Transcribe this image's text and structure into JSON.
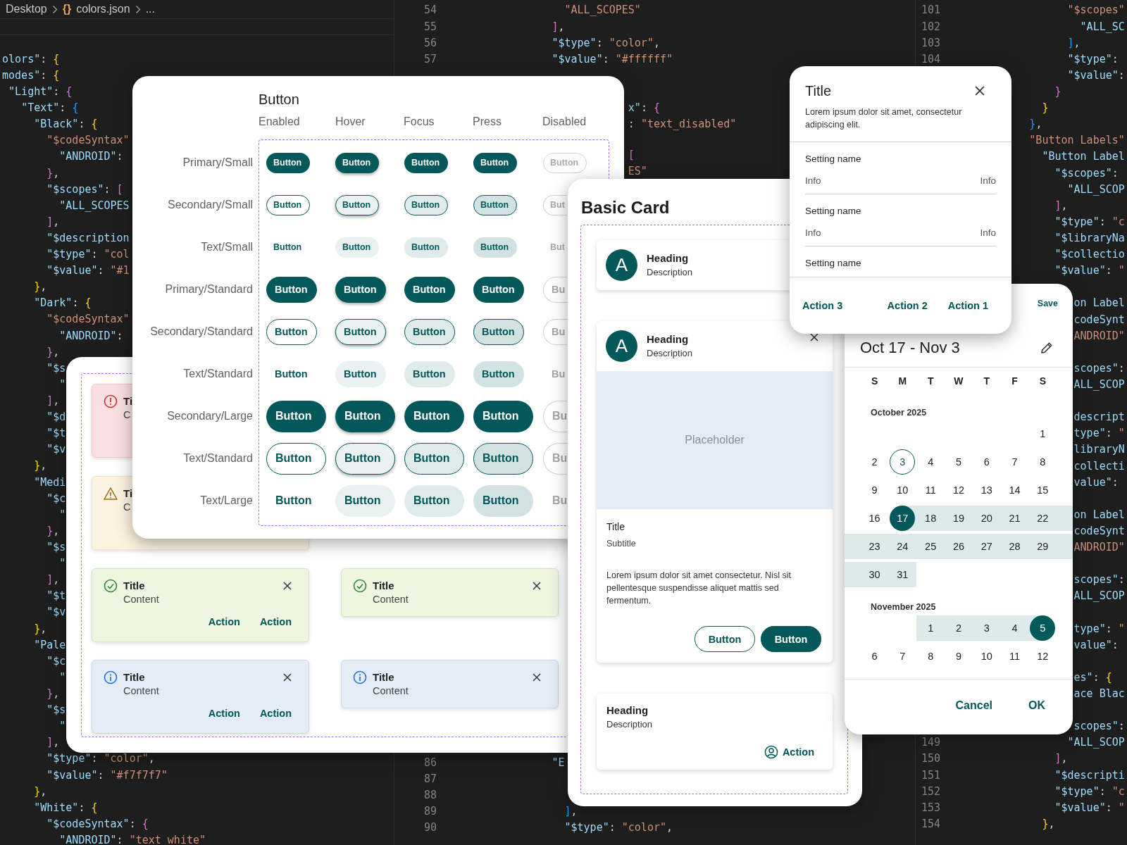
{
  "editor": {
    "breadcrumb": {
      "folder": "Desktop",
      "file_icon": "{}",
      "file": "colors.json",
      "more": "..."
    },
    "panes": [
      {
        "blocks": [
          {
            "lines": [
              {
                "text": " olors\": {"
              },
              {
                "text": " modes\": {"
              },
              {
                "text": "  \"Light\": {"
              },
              {
                "text": "    \"Text\": {"
              },
              {
                "text": "      \"Black\": {"
              },
              {
                "text": "        \"$codeSyntax\""
              },
              {
                "text": "          \"ANDROID\":"
              },
              {
                "text": "        },"
              },
              {
                "text": "        \"$scopes\": ["
              },
              {
                "text": "          \"ALL_SCOPES"
              },
              {
                "text": "        ],"
              },
              {
                "text": "        \"$description"
              },
              {
                "text": "        \"$type\": \"col"
              },
              {
                "text": "        \"$value\": \"#1"
              },
              {
                "text": "      },"
              },
              {
                "text": "      \"Dark\": {"
              },
              {
                "text": "        \"$codeSyntax\""
              },
              {
                "text": "          \"ANDROID\":"
              },
              {
                "text": "        },"
              },
              {
                "text": "        \"$s"
              },
              {
                "text": "          \""
              },
              {
                "text": "        ],"
              },
              {
                "text": "        \"$d"
              },
              {
                "text": "        \"$t"
              },
              {
                "text": "        \"$v"
              },
              {
                "text": "      },"
              },
              {
                "text": "      \"Medi"
              },
              {
                "text": "        \"$c"
              },
              {
                "text": "          \""
              },
              {
                "text": "        },"
              },
              {
                "text": "        \"$s"
              },
              {
                "text": "          \""
              },
              {
                "text": "        ],"
              },
              {
                "text": "        \"$t"
              },
              {
                "text": "        \"$v"
              },
              {
                "text": "      },"
              },
              {
                "text": "      \"Pale"
              },
              {
                "text": "        \"$c"
              },
              {
                "text": "          \""
              },
              {
                "text": "        },"
              },
              {
                "text": "        \"$s"
              },
              {
                "text": "          \""
              },
              {
                "text": "        ],"
              },
              {
                "text": "        \"$type\": \"color\","
              },
              {
                "text": "        \"$value\": \"#f7f7f7\""
              },
              {
                "text": "      },"
              },
              {
                "text": "      \"White\": {"
              },
              {
                "text": "        \"$codeSyntax\": {"
              },
              {
                "text": "          \"ANDROID\": \"text_white\""
              }
            ]
          }
        ]
      },
      {
        "blocks": [
          {
            "lines": [
              {
                "number": "54",
                "text": "                \"ALL_SCOPES\""
              },
              {
                "number": "55",
                "text": "              ],"
              },
              {
                "number": "56",
                "text": "              \"$type\": \"color\","
              },
              {
                "number": "57",
                "text": "              \"$value\": \"#ffffff\""
              }
            ]
          },
          {
            "lines": [
              {
                "text": "                          x\": {"
              },
              {
                "text": "                          : \"text_disabled\""
              }
            ]
          },
          {
            "lines": [
              {
                "text": "                          ["
              },
              {
                "text": "                          ES\""
              }
            ]
          },
          {
            "lines": [
              {
                "number": "86",
                "text": "              \"E"
              },
              {
                "number": "87"
              },
              {
                "number": "88"
              },
              {
                "number": "89",
                "text": "                ],"
              },
              {
                "number": "90",
                "text": "                \"$type\": \"color\","
              }
            ]
          }
        ]
      },
      {
        "blocks": [
          {
            "lines": [
              {
                "number": "101",
                "text": "                 \"$scopes\""
              },
              {
                "number": "102",
                "text": "                   \"ALL_SC"
              },
              {
                "number": "103",
                "text": "                 ],"
              },
              {
                "number": "104",
                "text": "                 \"$type\":"
              },
              {
                "text": "                 \"$value\":"
              },
              {
                "text": "               }"
              },
              {
                "text": "             }"
              },
              {
                "text": "           },"
              },
              {
                "text": "           \"Button Labels\""
              },
              {
                "text": "             \"Button Label"
              },
              {
                "text": "               \"$scopes\":"
              },
              {
                "text": "                 \"ALL_SCOP"
              },
              {
                "text": "               ],"
              },
              {
                "text": "               \"$type\": \"c"
              },
              {
                "text": "               \"$libraryNa"
              },
              {
                "text": "               \"$collectio"
              },
              {
                "text": "               \"$value\": \""
              }
            ]
          },
          {
            "lines": [
              {
                "text": "                  on Label"
              },
              {
                "text": "                  codeSynt"
              },
              {
                "text": "                  ANDROID\""
              }
            ]
          },
          {
            "lines": [
              {
                "text": "                  scopes\":"
              },
              {
                "text": "                  ALL_SCOP"
              }
            ]
          },
          {
            "lines": [
              {
                "text": "                  descript"
              },
              {
                "text": "                  type\": \""
              },
              {
                "text": "                  libraryN"
              },
              {
                "text": "                  collecti"
              },
              {
                "text": "                  value\":"
              }
            ]
          },
          {
            "lines": [
              {
                "text": "                  on Label"
              },
              {
                "text": "                  codeSynt"
              },
              {
                "text": "                  ANDROID\""
              }
            ]
          },
          {
            "lines": [
              {
                "text": "                  scopes\":"
              },
              {
                "text": "                  ALL_SCOP"
              }
            ]
          },
          {
            "lines": [
              {
                "text": "                  type\": \""
              },
              {
                "text": "                  value\":"
              }
            ]
          },
          {
            "lines": [
              {
                "text": "                  es\": {"
              },
              {
                "text": "                  ace Blac"
              }
            ]
          },
          {
            "lines": [
              {
                "text": "                  scopes\":"
              },
              {
                "number": "149",
                "text": "                 \"ALL_SCOP"
              },
              {
                "number": "150",
                "text": "               ],"
              },
              {
                "number": "151",
                "text": "               \"$descripti"
              },
              {
                "number": "152",
                "text": "               \"$type\": \"c"
              },
              {
                "number": "153",
                "text": "               \"$value\": \""
              },
              {
                "number": "154",
                "text": "             },"
              }
            ]
          }
        ]
      }
    ]
  },
  "alerts": [
    {
      "kind": "error",
      "title": "Ti",
      "content": "C"
    },
    {
      "kind": "warning",
      "title": "Ti",
      "content": "C"
    },
    {
      "kind": "success",
      "title": "Title",
      "content": "Content",
      "closable": true,
      "actions": [
        "Action",
        "Action"
      ]
    },
    {
      "kind": "success",
      "title": "Title",
      "content": "Content",
      "closable": true
    },
    {
      "kind": "info",
      "title": "Title",
      "content": "Content",
      "closable": true,
      "actions": [
        "Action",
        "Action"
      ]
    },
    {
      "kind": "info",
      "title": "Title",
      "content": "Content",
      "closable": true
    }
  ],
  "button_matrix": {
    "title": "Button",
    "columns": [
      "Enabled",
      "Hover",
      "Focus",
      "Press",
      "Disabled"
    ],
    "rows": [
      {
        "label": "Primary/Small",
        "kind": "primary",
        "buttons": [
          {
            "label": "Button",
            "kind": "enabled"
          },
          {
            "label": "Button",
            "kind": "hover"
          },
          {
            "label": "Button",
            "kind": "focus"
          },
          {
            "label": "Button",
            "kind": "press"
          },
          {
            "label": "Button",
            "kind": "disabled"
          }
        ]
      },
      {
        "label": "Secondary/Small",
        "kind": "secondary",
        "buttons": [
          {
            "label": "Button",
            "kind": "enabled"
          },
          {
            "label": "Button",
            "kind": "hover"
          },
          {
            "label": "Button",
            "kind": "focus"
          },
          {
            "label": "Button",
            "kind": "press"
          },
          {
            "label": "But",
            "kind": "disabled"
          }
        ]
      },
      {
        "label": "Text/Small",
        "kind": "text",
        "buttons": [
          {
            "label": "Button",
            "kind": "enabled"
          },
          {
            "label": "Button",
            "kind": "hover"
          },
          {
            "label": "Button",
            "kind": "focus"
          },
          {
            "label": "Button",
            "kind": "press"
          },
          {
            "label": "But",
            "kind": "disabled"
          }
        ]
      },
      {
        "label": "Primary/Standard",
        "kind": "primary",
        "buttons": [
          {
            "label": "Button",
            "kind": "enabled"
          },
          {
            "label": "Button",
            "kind": "hover"
          },
          {
            "label": "Button",
            "kind": "focus"
          },
          {
            "label": "Button",
            "kind": "press"
          },
          {
            "label": "Bu",
            "kind": "disabled"
          }
        ]
      },
      {
        "label": "Secondary/Standard",
        "kind": "secondary",
        "buttons": [
          {
            "label": "Button",
            "kind": "enabled"
          },
          {
            "label": "Button",
            "kind": "hover"
          },
          {
            "label": "Button",
            "kind": "focus"
          },
          {
            "label": "Button",
            "kind": "press"
          },
          {
            "label": "Bu",
            "kind": "disabled"
          }
        ]
      },
      {
        "label": "Text/Standard",
        "kind": "text",
        "buttons": [
          {
            "label": "Button",
            "kind": "enabled"
          },
          {
            "label": "Button",
            "kind": "hover"
          },
          {
            "label": "Button",
            "kind": "focus"
          },
          {
            "label": "Button",
            "kind": "press"
          },
          {
            "label": "Bu",
            "kind": "disabled"
          }
        ]
      },
      {
        "label": "Secondary/Large",
        "kind": "primary",
        "buttons": [
          {
            "label": "Button",
            "kind": "enabled"
          },
          {
            "label": "Button",
            "kind": "hover"
          },
          {
            "label": "Button",
            "kind": "focus"
          },
          {
            "label": "Button",
            "kind": "press"
          },
          {
            "label": "Bu",
            "kind": "disabled"
          }
        ]
      },
      {
        "label": "Text/Standard",
        "kind": "secondary",
        "buttons": [
          {
            "label": "Button",
            "kind": "enabled"
          },
          {
            "label": "Button",
            "kind": "hover"
          },
          {
            "label": "Button",
            "kind": "focus"
          },
          {
            "label": "Button",
            "kind": "press"
          },
          {
            "label": "Bu",
            "kind": "disabled"
          }
        ]
      },
      {
        "label": "Text/Large",
        "kind": "text",
        "buttons": [
          {
            "label": "Button",
            "kind": "enabled"
          },
          {
            "label": "Button",
            "kind": "hover"
          },
          {
            "label": "Button",
            "kind": "focus"
          },
          {
            "label": "Button",
            "kind": "press"
          },
          {
            "label": "Bu",
            "kind": "disabled"
          }
        ]
      }
    ]
  },
  "basic_card": {
    "title": "Basic Card",
    "cards": [
      {
        "avatar": "A",
        "heading": "Heading",
        "description": "Description"
      },
      {
        "avatar": "A",
        "heading": "Heading",
        "description": "Description",
        "closable": true,
        "placeholder": "Placeholder",
        "title": "Title",
        "subtitle": "Subtitle",
        "body": "Lorem ipsum dolor sit amet consectetur. Nisl sit pellentesque suspendisse aliquet mattis sed fermentum.",
        "buttons": [
          {
            "label": "Button",
            "kind": "outlined"
          },
          {
            "label": "Button",
            "kind": "filled"
          }
        ]
      },
      {
        "heading": "Heading",
        "description": "Description",
        "action": "Action"
      }
    ]
  },
  "date_picker": {
    "save": "Save",
    "range": "Oct 17 - Nov 3",
    "weekdays": [
      "S",
      "M",
      "T",
      "W",
      "T",
      "F",
      "S"
    ],
    "months": [
      {
        "name": "October 2025",
        "weeks": [
          [
            {
              "day": "1",
              "kind": "plain"
            }
          ],
          [
            {
              "day": "2",
              "kind": "plain"
            },
            {
              "day": "3",
              "kind": "today"
            },
            {
              "day": "4",
              "kind": "plain"
            },
            {
              "day": "5",
              "kind": "plain"
            },
            {
              "day": "6",
              "kind": "plain"
            },
            {
              "day": "7",
              "kind": "plain"
            },
            {
              "day": "8",
              "kind": "plain"
            }
          ],
          [
            {
              "day": "9",
              "kind": "plain"
            },
            {
              "day": "10",
              "kind": "plain"
            },
            {
              "day": "11",
              "kind": "plain"
            },
            {
              "day": "12",
              "kind": "plain"
            },
            {
              "day": "13",
              "kind": "plain"
            },
            {
              "day": "14",
              "kind": "plain"
            },
            {
              "day": "15",
              "kind": "plain"
            }
          ],
          [
            {
              "day": "16",
              "kind": "plain"
            },
            {
              "day": "17",
              "kind": "start"
            },
            {
              "day": "18",
              "kind": "range"
            },
            {
              "day": "19",
              "kind": "range"
            },
            {
              "day": "20",
              "kind": "range"
            },
            {
              "day": "21",
              "kind": "range"
            },
            {
              "day": "22",
              "kind": "range"
            }
          ],
          [
            {
              "day": "23",
              "kind": "range"
            },
            {
              "day": "24",
              "kind": "range"
            },
            {
              "day": "25",
              "kind": "range"
            },
            {
              "day": "26",
              "kind": "range"
            },
            {
              "day": "27",
              "kind": "range"
            },
            {
              "day": "28",
              "kind": "range"
            },
            {
              "day": "29",
              "kind": "range"
            }
          ],
          [
            {
              "day": "30",
              "kind": "range"
            },
            {
              "day": "31",
              "kind": "range"
            }
          ]
        ]
      },
      {
        "name": "November 2025",
        "weeks": [
          [
            {
              "day": "1",
              "kind": "range"
            },
            {
              "day": "2",
              "kind": "range"
            },
            {
              "day": "3",
              "kind": "range"
            },
            {
              "day": "4",
              "kind": "range"
            },
            {
              "day": "5",
              "kind": "end"
            }
          ],
          [
            {
              "day": "6",
              "kind": "plain"
            },
            {
              "day": "7",
              "kind": "plain"
            },
            {
              "day": "8",
              "kind": "plain"
            },
            {
              "day": "9",
              "kind": "plain"
            },
            {
              "day": "10",
              "kind": "plain"
            },
            {
              "day": "11",
              "kind": "plain"
            },
            {
              "day": "12",
              "kind": "plain"
            }
          ]
        ]
      }
    ],
    "actions": [
      "Cancel",
      "OK"
    ]
  },
  "dialog": {
    "title": "Title",
    "body": "Lorem ipsum dolor sit amet, consectetur adipiscing elit.",
    "settings": [
      {
        "name": "Setting name",
        "info": "Info",
        "value": "Info"
      },
      {
        "name": "Setting name",
        "info": "Info",
        "value": "Info"
      },
      {
        "name": "Setting name"
      }
    ],
    "actions": [
      "Action 3",
      "Action 2",
      "Action 1"
    ]
  }
}
